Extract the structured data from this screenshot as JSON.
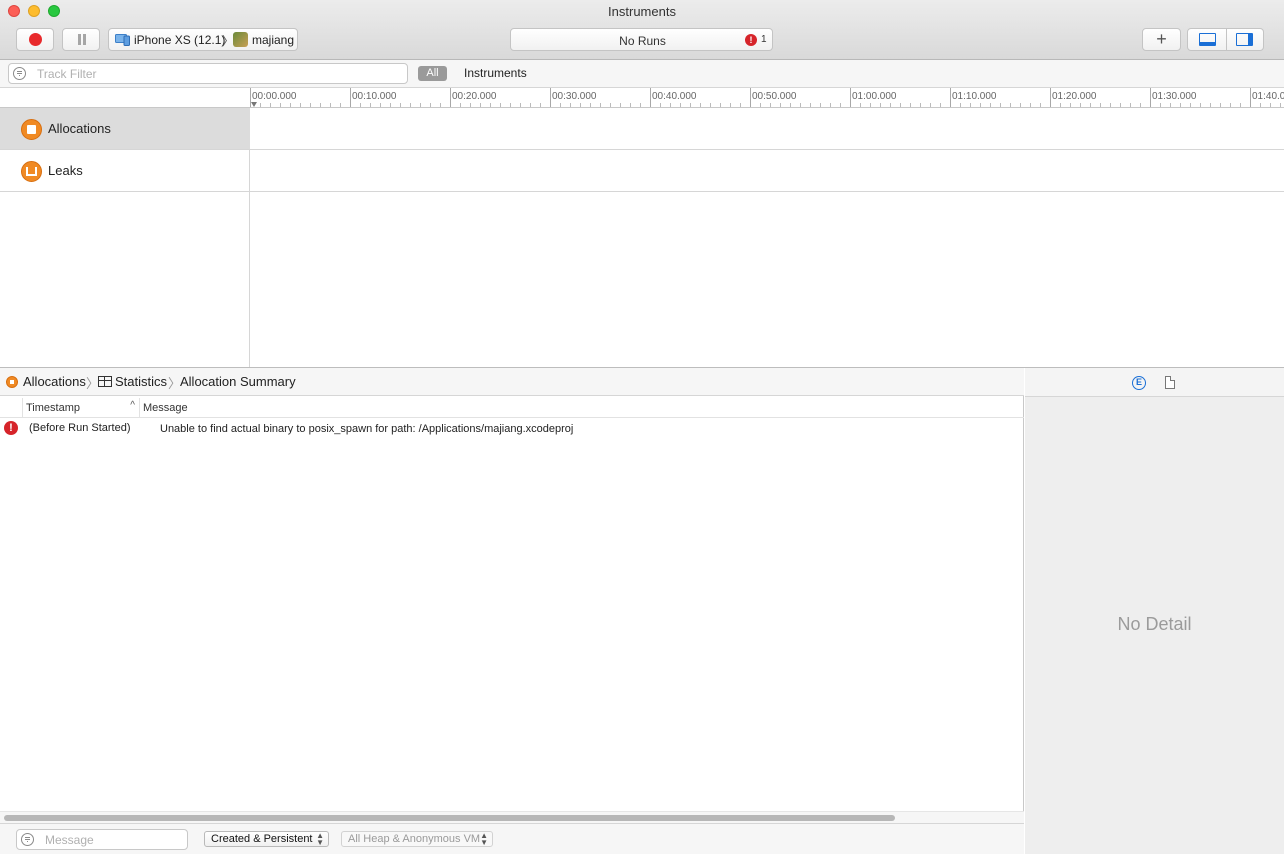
{
  "window": {
    "title": "Instruments"
  },
  "toolbar": {
    "device_label": "iPhone XS (12.1)",
    "separator": "〉",
    "app_label": "majiang",
    "runs_label": "No Runs",
    "error_count": "1",
    "error_glyph": "!",
    "add_glyph": "+"
  },
  "filter_bar": {
    "track_filter_placeholder": "Track Filter",
    "all_label": "All",
    "instruments_label": "Instruments"
  },
  "ruler": {
    "labels": [
      "00:00.000",
      "00:10.000",
      "00:20.000",
      "00:30.000",
      "00:40.000",
      "00:50.000",
      "01:00.000",
      "01:10.000",
      "01:20.000",
      "01:30.000",
      "01:40.0"
    ]
  },
  "tracks": [
    {
      "label": "Allocations",
      "icon": "allocations-icon",
      "selected": true
    },
    {
      "label": "Leaks",
      "icon": "leaks-icon",
      "selected": false
    }
  ],
  "jump_bar": {
    "items": [
      "Allocations",
      "Statistics",
      "Allocation Summary"
    ],
    "separator": "〉"
  },
  "log_table": {
    "columns": [
      "Timestamp",
      "Message"
    ],
    "sort_indicator": "^",
    "rows": [
      {
        "level_glyph": "!",
        "timestamp": "(Before Run Started)",
        "message": "Unable to find actual binary to posix_spawn for path: /Applications/majiang.xcodeproj"
      }
    ]
  },
  "bottom_bar": {
    "message_placeholder": "Message",
    "mode_popup": "Created & Persistent",
    "heap_popup": "All Heap & Anonymous VM"
  },
  "inspector": {
    "ext_glyph": "E",
    "empty_text": "No Detail"
  },
  "colors": {
    "record": "#e8292b",
    "accent": "#1a6fd6",
    "instrument_orange": "#f08a24",
    "error": "#d6242a"
  }
}
